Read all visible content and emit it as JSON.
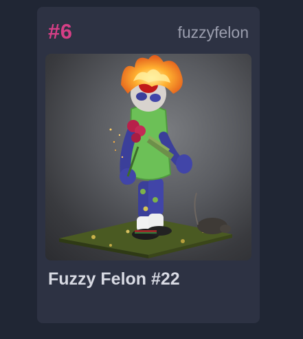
{
  "card": {
    "rank": "#6",
    "owner": "fuzzyfelon",
    "title": "Fuzzy Felon #22"
  },
  "colors": {
    "background": "#202634",
    "card": "#2d3243",
    "rank": "#d63f86",
    "owner": "#9b9eae",
    "title": "#d8dae3"
  }
}
